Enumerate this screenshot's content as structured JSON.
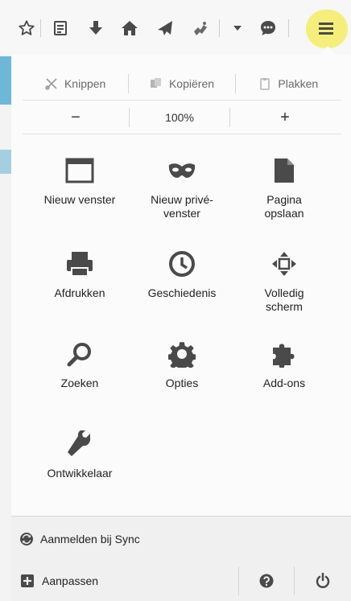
{
  "toolbar": {
    "icons": [
      "star-icon",
      "reading-list-icon",
      "download-icon",
      "home-icon",
      "send-icon",
      "extension-icon",
      "dropdown-icon",
      "chat-icon",
      "hamburger-menu-icon"
    ]
  },
  "edit": {
    "cut": "Knippen",
    "copy": "Kopiëren",
    "paste": "Plakken"
  },
  "zoom": {
    "minus": "−",
    "level": "100%",
    "plus": "+"
  },
  "items": [
    {
      "label": "Nieuw venster",
      "icon": "window-icon"
    },
    {
      "label": "Nieuw privé-venster",
      "icon": "mask-icon"
    },
    {
      "label": "Pagina opslaan",
      "icon": "page-icon"
    },
    {
      "label": "Afdrukken",
      "icon": "printer-icon"
    },
    {
      "label": "Geschiedenis",
      "icon": "clock-icon"
    },
    {
      "label": "Volledig scherm",
      "icon": "fullscreen-icon"
    },
    {
      "label": "Zoeken",
      "icon": "search-icon"
    },
    {
      "label": "Opties",
      "icon": "gear-icon"
    },
    {
      "label": "Add-ons",
      "icon": "puzzle-icon"
    },
    {
      "label": "Ontwikkelaar",
      "icon": "wrench-icon"
    }
  ],
  "sync": {
    "label": "Aanmelden bij Sync"
  },
  "customize": {
    "label": "Aanpassen"
  },
  "colors": {
    "highlight": "#f5ee7a",
    "icon": "#4a4a4a",
    "accent_strip": "#6eb7d6"
  }
}
